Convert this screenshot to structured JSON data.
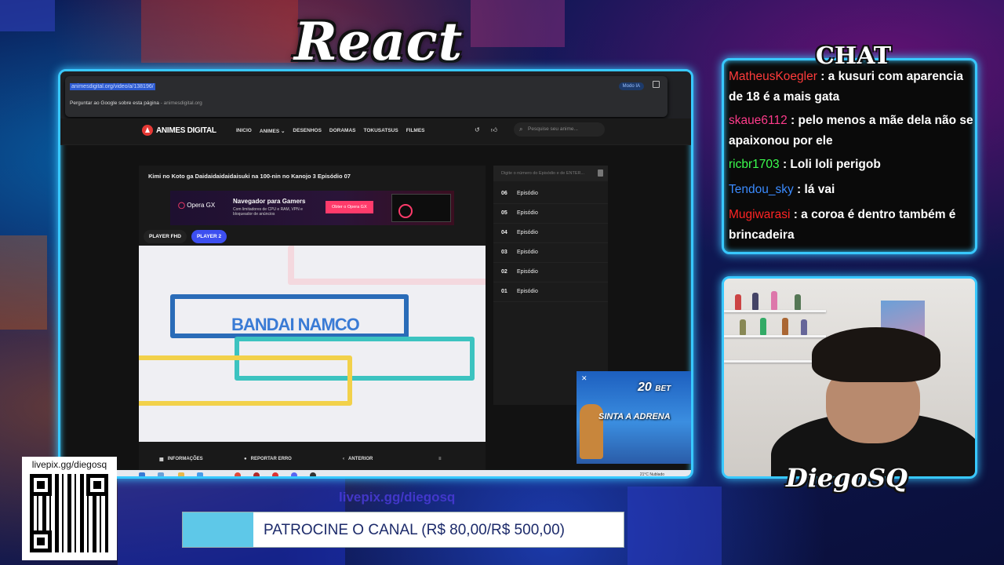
{
  "stream": {
    "title": "React",
    "chat_title": "CHAT",
    "streamer_name": "DiegoSQ",
    "qr_label": "livepix.gg/diegosq",
    "livepix_url": "livepix.gg/diegosq",
    "sponsor_text": "PATROCINE O CANAL (R$ 80,00/R$ 500,00)",
    "sponsor_progress": 0.16
  },
  "browser": {
    "url": "animesdigital.org/video/a/138196/",
    "modo_ia": "Modo IA",
    "suggestion_main": "Perguntar ao Google sobre esta página",
    "suggestion_domain": "animesdigital.org"
  },
  "site": {
    "logo": "ANIMES DIGITAL",
    "nav": [
      "INICIO",
      "ANIMES ⌄",
      "DESENHOS",
      "DORAMAS",
      "TOKUSATSUS",
      "FILMES"
    ],
    "search_placeholder": "Pesquise seu anime...",
    "episode_title": "Kimi no Koto ga Daidaidaidaidaisuki na 100-nin no Kanojo 3 Episódio 07",
    "ad": {
      "brand": "Opera GX",
      "headline": "Navegador para Gamers",
      "sub": "Com limitadores de CPU e RAM, VPN e bloqueador de anúncios",
      "cta": "Obter o Opera GX"
    },
    "players": [
      "PLAYER FHD",
      "PLAYER 2"
    ],
    "video_logo": "BANDAI NAMCO",
    "controls": [
      "INFORMAÇÕES",
      "REPORTAR ERRO",
      "ANTERIOR"
    ],
    "episode_search_placeholder": "Digite o número do Episódio e de ENTER...",
    "episodes": [
      {
        "num": "06",
        "label": "Episódio"
      },
      {
        "num": "05",
        "label": "Episódio"
      },
      {
        "num": "04",
        "label": "Episódio"
      },
      {
        "num": "03",
        "label": "Episódio"
      },
      {
        "num": "02",
        "label": "Episódio"
      },
      {
        "num": "01",
        "label": "Episódio"
      }
    ],
    "popup_ad": {
      "brand": "20",
      "brand_suffix": "BET",
      "slogan": "SINTA A ADRENA"
    }
  },
  "taskbar": {
    "time": "21°C  Nublado"
  },
  "chat": [
    {
      "user": "MatheusKoegler",
      "color": "#ff3b3b",
      "text": ": a kusuri com aparencia de 18 é a mais gata"
    },
    {
      "user": "skaue6112",
      "color": "#ff3b8b",
      "text": ": pelo menos a mãe dela não se apaixonou por ele"
    },
    {
      "user": "ricbr1703",
      "color": "#3bff4e",
      "text": ": Loli loli perigob"
    },
    {
      "user": "Tendou_sky",
      "color": "#3b8bff",
      "text": ": lá vai"
    },
    {
      "user": "Mugiwarasi",
      "color": "#ff2424",
      "text": ": a coroa é dentro também é brincadeira"
    }
  ],
  "colors": {
    "accent": "#38c8ff",
    "player_active": "#3d4ff0",
    "ad_cta": "#ff3b6b"
  }
}
